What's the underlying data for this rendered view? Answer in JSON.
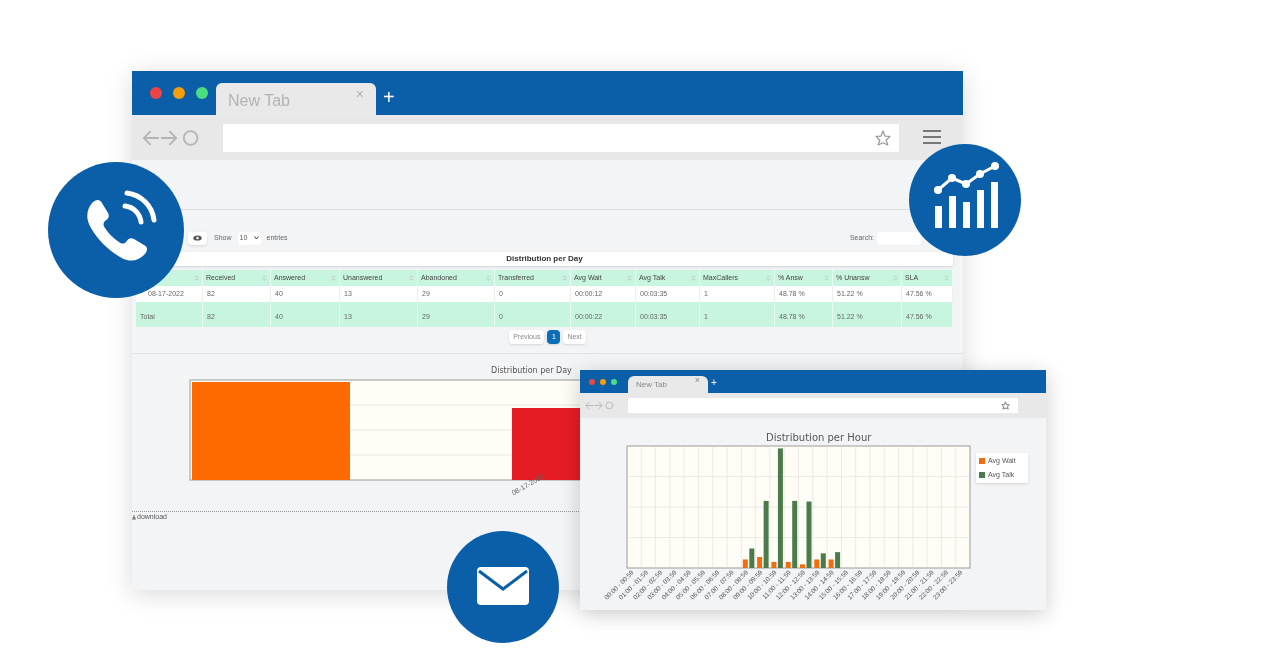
{
  "main_window": {
    "tab": {
      "title": "New Tab",
      "close": "×"
    },
    "new_tab": "+",
    "table_controls": {
      "show_label": "Show",
      "entries_select": "10",
      "entries_label": "entries",
      "search_label": "Search:"
    },
    "table": {
      "title": "Distribution per Day",
      "columns": [
        "",
        "Received",
        "Answered",
        "Unanswered",
        "Abandoned",
        "Transferred",
        "Avg Wait",
        "Avg Talk",
        "MaxCallers",
        "% Answ",
        "% Unansw",
        "SLA"
      ],
      "rows": [
        [
          "08-17-2022",
          "82",
          "40",
          "13",
          "29",
          "0",
          "00:00:12",
          "00:03:35",
          "1",
          "48.78 %",
          "51.22 %",
          "47.56 %"
        ]
      ],
      "total": [
        "Total",
        "82",
        "40",
        "13",
        "29",
        "0",
        "00:00:22",
        "00:03:35",
        "1",
        "48.78 %",
        "51.22 %",
        "47.56 %"
      ]
    },
    "pagination": [
      {
        "label": "Previous",
        "selected": false
      },
      {
        "label": "1",
        "selected": true
      },
      {
        "label": "Next",
        "selected": false
      }
    ],
    "day_chart": {
      "title": "Distribution per Day",
      "x_label": "08-17-2022"
    },
    "download": "download"
  },
  "hour_window": {
    "tab": {
      "title": "New Tab",
      "close": "×"
    },
    "new_tab": "+",
    "hour_chart": {
      "title": "Distribution per Hour",
      "legend": [
        {
          "label": "Avg Wait",
          "color": "#f26b0f"
        },
        {
          "label": "Avg Talk",
          "color": "#4b7b4b"
        }
      ],
      "hours": [
        "00:00 - 00:59",
        "01:00 - 01:59",
        "02:00 - 02:59",
        "03:00 - 03:59",
        "04:00 - 04:59",
        "05:00 - 05:59",
        "06:00 - 06:59",
        "07:00 - 07:59",
        "08:00 - 08:59",
        "09:00 - 09:59",
        "10:00 - 10:59",
        "11:00 - 11:59",
        "12:00 - 12:59",
        "13:00 - 13:59",
        "14:00 - 14:59",
        "15:00 - 15:59",
        "16:00 - 16:59",
        "17:00 - 17:59",
        "18:00 - 18:59",
        "19:00 - 19:59",
        "20:00 - 20:59",
        "21:00 - 21:59",
        "22:00 - 22:59",
        "23:00 - 23:59"
      ]
    }
  }
}
